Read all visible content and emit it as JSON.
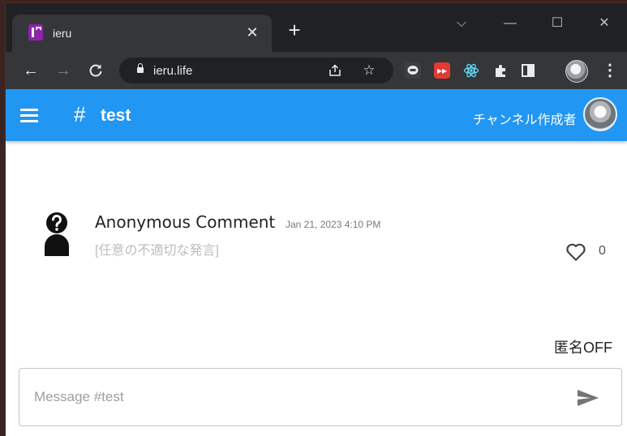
{
  "browser": {
    "tab": {
      "title": "ieru",
      "close_glyph": "✕"
    },
    "new_tab_glyph": "+",
    "window_controls": {
      "dropdown": "⌵",
      "minimize": "—",
      "maximize": "☐",
      "close": "✕"
    },
    "nav": {
      "back": "←",
      "forward": "→",
      "reload": "C"
    },
    "url": "ieru.life",
    "omnibox_icons": [
      "share-icon",
      "star-icon"
    ],
    "extensions": [
      "line-extension-icon",
      "youtube-extension-icon",
      "react-devtools-icon",
      "puzzle-extensions-icon",
      "sidepanel-icon"
    ],
    "menu_glyph": "⋮"
  },
  "appbar": {
    "hash_glyph": "#",
    "channel_name": "test",
    "creator_label": "チャンネル作成者",
    "color": "#2196f3"
  },
  "comments": [
    {
      "author": "Anonymous Comment",
      "timestamp": "Jan 21, 2023 4:10 PM",
      "body": "[任意の不適切な発言]",
      "likes": "0"
    }
  ],
  "anon_toggle": "匿名OFF",
  "composer": {
    "placeholder": "Message #test"
  }
}
